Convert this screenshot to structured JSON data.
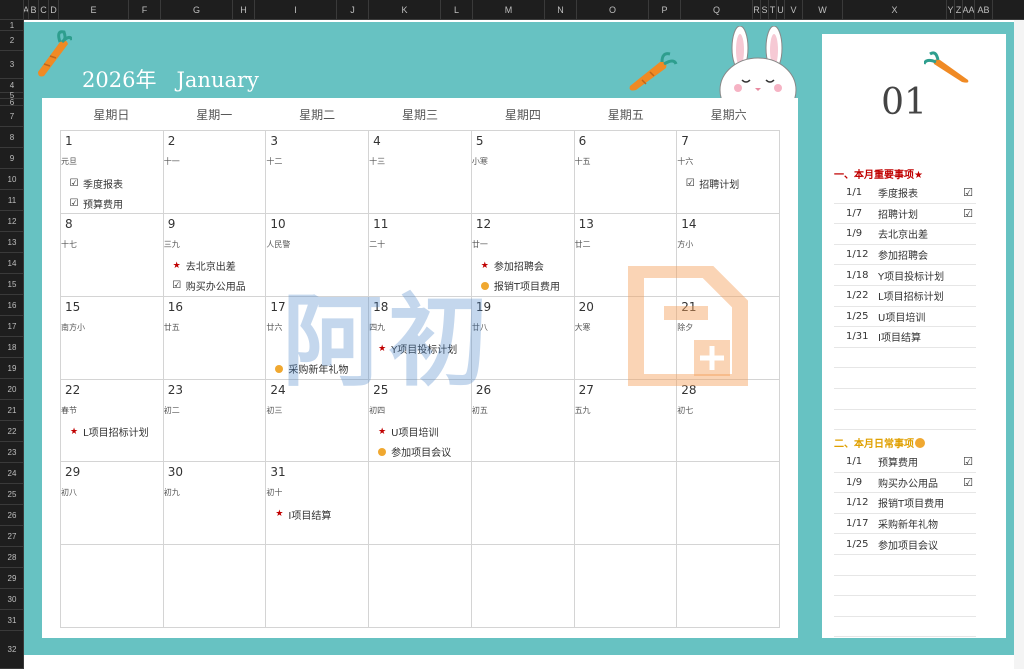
{
  "column_headers": [
    "A",
    "B",
    "C",
    "D",
    "E",
    "F",
    "G",
    "H",
    "I",
    "J",
    "K",
    "L",
    "M",
    "N",
    "O",
    "P",
    "Q",
    "R",
    "S",
    "T",
    "U",
    "V",
    "W",
    "X",
    "Y",
    "Z",
    "AA",
    "AB"
  ],
  "row_headers": [
    "1",
    "2",
    "3",
    "4",
    "5",
    "6",
    "7",
    "8",
    "9",
    "10",
    "11",
    "12",
    "13",
    "14",
    "15",
    "16",
    "17",
    "18",
    "19",
    "20",
    "21",
    "22",
    "23",
    "24",
    "25",
    "26",
    "27",
    "28",
    "29",
    "30",
    "31",
    "32"
  ],
  "calendar": {
    "year_label": "2026年",
    "month_label": "January",
    "weekdays": [
      "星期日",
      "星期一",
      "星期二",
      "星期三",
      "星期四",
      "星期五",
      "星期六"
    ],
    "cells": [
      {
        "day": "1",
        "lunar": "元旦",
        "events": [
          {
            "mark": "check",
            "text": "季度报表"
          },
          {
            "mark": "check",
            "text": "预算费用"
          }
        ]
      },
      {
        "day": "2",
        "lunar": "十一",
        "events": []
      },
      {
        "day": "3",
        "lunar": "十二",
        "events": []
      },
      {
        "day": "4",
        "lunar": "十三",
        "events": []
      },
      {
        "day": "5",
        "lunar": "小寒",
        "events": []
      },
      {
        "day": "6",
        "lunar": "十五",
        "events": []
      },
      {
        "day": "7",
        "lunar": "十六",
        "events": [
          {
            "mark": "check",
            "text": "招聘计划"
          }
        ]
      },
      {
        "day": "8",
        "lunar": "十七",
        "events": []
      },
      {
        "day": "9",
        "lunar": "三九",
        "events": [
          {
            "mark": "star",
            "text": "去北京出差"
          },
          {
            "mark": "check",
            "text": "购买办公用品"
          }
        ]
      },
      {
        "day": "10",
        "lunar": "人民警",
        "events": []
      },
      {
        "day": "11",
        "lunar": "二十",
        "events": []
      },
      {
        "day": "12",
        "lunar": "廿一",
        "events": [
          {
            "mark": "star",
            "text": "参加招聘会"
          },
          {
            "mark": "dot",
            "text": "报销T项目费用"
          }
        ]
      },
      {
        "day": "13",
        "lunar": "廿二",
        "events": []
      },
      {
        "day": "14",
        "lunar": "方小",
        "events": []
      },
      {
        "day": "15",
        "lunar": "南方小",
        "events": []
      },
      {
        "day": "16",
        "lunar": "廿五",
        "events": []
      },
      {
        "day": "17",
        "lunar": "廿六",
        "events": [
          {
            "mark": "",
            "text": ""
          },
          {
            "mark": "dot",
            "text": "采购新年礼物"
          }
        ]
      },
      {
        "day": "18",
        "lunar": "四九",
        "events": [
          {
            "mark": "star",
            "text": "Y项目投标计划"
          }
        ]
      },
      {
        "day": "19",
        "lunar": "廿八",
        "events": []
      },
      {
        "day": "20",
        "lunar": "大寒",
        "events": []
      },
      {
        "day": "21",
        "lunar": "除夕",
        "events": []
      },
      {
        "day": "22",
        "lunar": "春节",
        "events": [
          {
            "mark": "star",
            "text": "L项目招标计划"
          }
        ]
      },
      {
        "day": "23",
        "lunar": "初二",
        "events": []
      },
      {
        "day": "24",
        "lunar": "初三",
        "events": []
      },
      {
        "day": "25",
        "lunar": "初四",
        "events": [
          {
            "mark": "star",
            "text": "U项目培训"
          },
          {
            "mark": "dot",
            "text": "参加项目会议"
          }
        ]
      },
      {
        "day": "26",
        "lunar": "初五",
        "events": []
      },
      {
        "day": "27",
        "lunar": "五九",
        "events": []
      },
      {
        "day": "28",
        "lunar": "初七",
        "events": []
      },
      {
        "day": "29",
        "lunar": "初八",
        "events": []
      },
      {
        "day": "30",
        "lunar": "初九",
        "events": []
      },
      {
        "day": "31",
        "lunar": "初十",
        "events": [
          {
            "mark": "star",
            "text": "I项目结算"
          }
        ]
      },
      {
        "day": "",
        "lunar": "",
        "events": []
      },
      {
        "day": "",
        "lunar": "",
        "events": []
      },
      {
        "day": "",
        "lunar": "",
        "events": []
      },
      {
        "day": "",
        "lunar": "",
        "events": []
      },
      {
        "day": "",
        "lunar": "",
        "events": []
      },
      {
        "day": "",
        "lunar": "",
        "events": []
      },
      {
        "day": "",
        "lunar": "",
        "events": []
      },
      {
        "day": "",
        "lunar": "",
        "events": []
      },
      {
        "day": "",
        "lunar": "",
        "events": []
      },
      {
        "day": "",
        "lunar": "",
        "events": []
      },
      {
        "day": "",
        "lunar": "",
        "events": []
      }
    ]
  },
  "watermark": {
    "text": "阿初"
  },
  "panel": {
    "month_number": "01",
    "important_title": "一、本月重要事项★",
    "important_items": [
      {
        "date": "1/1",
        "text": "季度报表",
        "checked": "☑"
      },
      {
        "date": "1/7",
        "text": "招聘计划",
        "checked": "☑"
      },
      {
        "date": "1/9",
        "text": "去北京出差",
        "checked": ""
      },
      {
        "date": "1/12",
        "text": "参加招聘会",
        "checked": ""
      },
      {
        "date": "1/18",
        "text": "Y项目投标计划",
        "checked": ""
      },
      {
        "date": "1/22",
        "text": "L项目招标计划",
        "checked": ""
      },
      {
        "date": "1/25",
        "text": "U项目培训",
        "checked": ""
      },
      {
        "date": "1/31",
        "text": "I项目结算",
        "checked": ""
      },
      {
        "date": "",
        "text": "",
        "checked": ""
      },
      {
        "date": "",
        "text": "",
        "checked": ""
      },
      {
        "date": "",
        "text": "",
        "checked": ""
      },
      {
        "date": "",
        "text": "",
        "checked": ""
      }
    ],
    "routine_title": "二、本月日常事项",
    "routine_items": [
      {
        "date": "1/1",
        "text": "预算费用",
        "checked": "☑"
      },
      {
        "date": "1/9",
        "text": "购买办公用品",
        "checked": "☑"
      },
      {
        "date": "1/12",
        "text": "报销T项目费用",
        "checked": ""
      },
      {
        "date": "1/17",
        "text": "采购新年礼物",
        "checked": ""
      },
      {
        "date": "1/25",
        "text": "参加项目会议",
        "checked": ""
      },
      {
        "date": "",
        "text": "",
        "checked": ""
      },
      {
        "date": "",
        "text": "",
        "checked": ""
      },
      {
        "date": "",
        "text": "",
        "checked": ""
      },
      {
        "date": "",
        "text": "",
        "checked": ""
      }
    ]
  },
  "colors": {
    "teal": "#67c2c2",
    "star": "#c00000",
    "dot": "#f0a830",
    "carrot": "#f08a24",
    "leaf": "#2e9e8e"
  }
}
